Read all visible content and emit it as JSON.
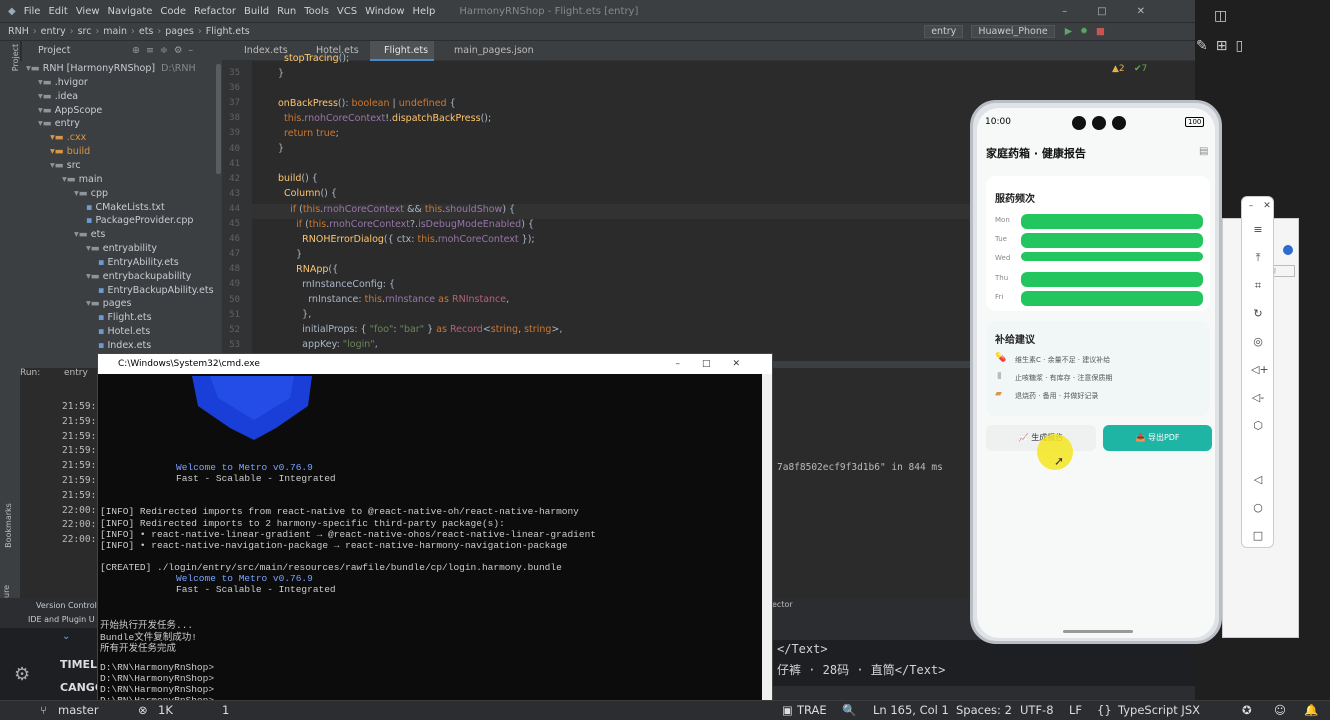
{
  "ide": {
    "menu": [
      "RNH",
      "File",
      "Edit",
      "View",
      "Navigate",
      "Code",
      "Refactor",
      "Build",
      "Run",
      "Tools",
      "VCS",
      "Window",
      "Help"
    ],
    "window_title": "HarmonyRNShop - Flight.ets [entry]",
    "breadcrumb": [
      "RNH",
      "entry",
      "src",
      "main",
      "ets",
      "pages",
      "Flight.ets"
    ],
    "run_config": "entry",
    "device": "Huawei_Phone",
    "project_label": "Project",
    "tabs": [
      "Index.ets",
      "Hotel.ets",
      "Flight.ets",
      "main_pages.json"
    ],
    "warnings": "▲2",
    "weak_warnings": "✔7",
    "project_tree": [
      {
        "label": "RNH [HarmonyRNShop]",
        "extra": "D:\\RNH",
        "depth": 0
      },
      {
        "label": ".hvigor",
        "depth": 1
      },
      {
        "label": ".idea",
        "depth": 1
      },
      {
        "label": "AppScope",
        "depth": 1
      },
      {
        "label": "entry",
        "depth": 1
      },
      {
        "label": ".cxx",
        "depth": 2
      },
      {
        "label": "build",
        "depth": 2
      },
      {
        "label": "src",
        "depth": 2
      },
      {
        "label": "main",
        "depth": 3
      },
      {
        "label": "cpp",
        "depth": 4
      },
      {
        "label": "CMakeLists.txt",
        "depth": 5
      },
      {
        "label": "PackageProvider.cpp",
        "depth": 5
      },
      {
        "label": "ets",
        "depth": 4
      },
      {
        "label": "entryability",
        "depth": 5
      },
      {
        "label": "EntryAbility.ets",
        "depth": 6
      },
      {
        "label": "entrybackupability",
        "depth": 5
      },
      {
        "label": "EntryBackupAbility.ets",
        "depth": 6
      },
      {
        "label": "pages",
        "depth": 5
      },
      {
        "label": "Flight.ets",
        "depth": 6
      },
      {
        "label": "Hotel.ets",
        "depth": 6
      },
      {
        "label": "Index.ets",
        "depth": 6
      }
    ],
    "line_numbers": [
      "35",
      "36",
      "37",
      "38",
      "39",
      "40",
      "41",
      "42",
      "43",
      "44",
      "45",
      "46",
      "47",
      "48",
      "49",
      "50",
      "51",
      "52",
      "53"
    ],
    "run_label": "Run:",
    "run_tab": "entry",
    "run_times": [
      "21:59:",
      "21:59:",
      "21:59:",
      "21:59:",
      "21:59:",
      "21:59:",
      "21:59:",
      "22:00:",
      "22:00:",
      "22:00:"
    ],
    "run_log_tail": "7a8f8502ecf9f3d1b6\" in 844 ms",
    "left_tabs": [
      "Bookmarks",
      "Structure"
    ],
    "bottom_tool_items": [
      "Version Control",
      "IDE and Plugin U"
    ],
    "tree_bottom": [
      "TIMEL",
      "CANGC"
    ],
    "inspector_label": "ector",
    "xml_lines": [
      "</Text>",
      "仔裤 · 28码 · 直筒</Text>"
    ]
  },
  "cmd": {
    "title": "C:\\Windows\\System32\\cmd.exe",
    "lines": [
      {
        "text": "Welcome to Metro v0.76.9",
        "indent": true,
        "color": "blue"
      },
      {
        "text": "Fast - Scalable - Integrated",
        "indent": true
      },
      {
        "text": ""
      },
      {
        "text": ""
      },
      {
        "text": "[INFO] Redirected imports from react-native to @react-native-oh/react-native-harmony"
      },
      {
        "text": "[INFO] Redirected imports to 2 harmony-specific third-party package(s):"
      },
      {
        "text": "[INFO] • react-native-linear-gradient → @react-native-ohos/react-native-linear-gradient"
      },
      {
        "text": "[INFO] • react-native-navigation-package → react-native-harmony-navigation-package"
      },
      {
        "text": ""
      },
      {
        "text": "[CREATED] ./login/entry/src/main/resources/rawfile/bundle/cp/login.harmony.bundle"
      },
      {
        "text": "Welcome to Metro v0.76.9",
        "indent": true,
        "color": "blue"
      },
      {
        "text": "Fast - Scalable - Integrated",
        "indent": true
      },
      {
        "text": ""
      },
      {
        "text": ""
      },
      {
        "text": "开始执行开发任务..."
      },
      {
        "text": "Bundle文件复制成功!"
      },
      {
        "text": "所有开发任务完成"
      },
      {
        "text": ""
      },
      {
        "text": "D:\\RN\\HarmonyRnShop>"
      },
      {
        "text": "D:\\RN\\HarmonyRnShop>"
      },
      {
        "text": "D:\\RN\\HarmonyRnShop>"
      },
      {
        "text": "D:\\RN\\HarmonyRnShop>"
      }
    ]
  },
  "phone": {
    "time": "10:00",
    "battery": "100",
    "title": "家庭药箱 · 健康报告",
    "freq_title": "服药频次",
    "days": [
      "Mon",
      "Tue",
      "Wed",
      "Thu",
      "Fri"
    ],
    "advice_title": "补给建议",
    "advice": [
      "维生素C · 余量不足 · 建议补给",
      "止咳糖浆 · 有库存 · 注意保质期",
      "退烧药 · 备用 · 并做好记录"
    ],
    "btn_generate": "生成报告",
    "btn_export": "导出PDF"
  },
  "status": {
    "branch": "master",
    "counts": "1K",
    "problems": "1",
    "ide_name": "TRAE",
    "position": "Ln 165, Col 1",
    "indent": "Spaces: 2",
    "encoding": "UTF-8",
    "eol": "LF",
    "language": "TypeScript JSX"
  },
  "bg_window": {
    "placeholder": "中搜"
  },
  "colors": {
    "accent_green": "#22c55e",
    "teal": "#1fb5a5",
    "cursor_yellow": "#f5e61e"
  }
}
